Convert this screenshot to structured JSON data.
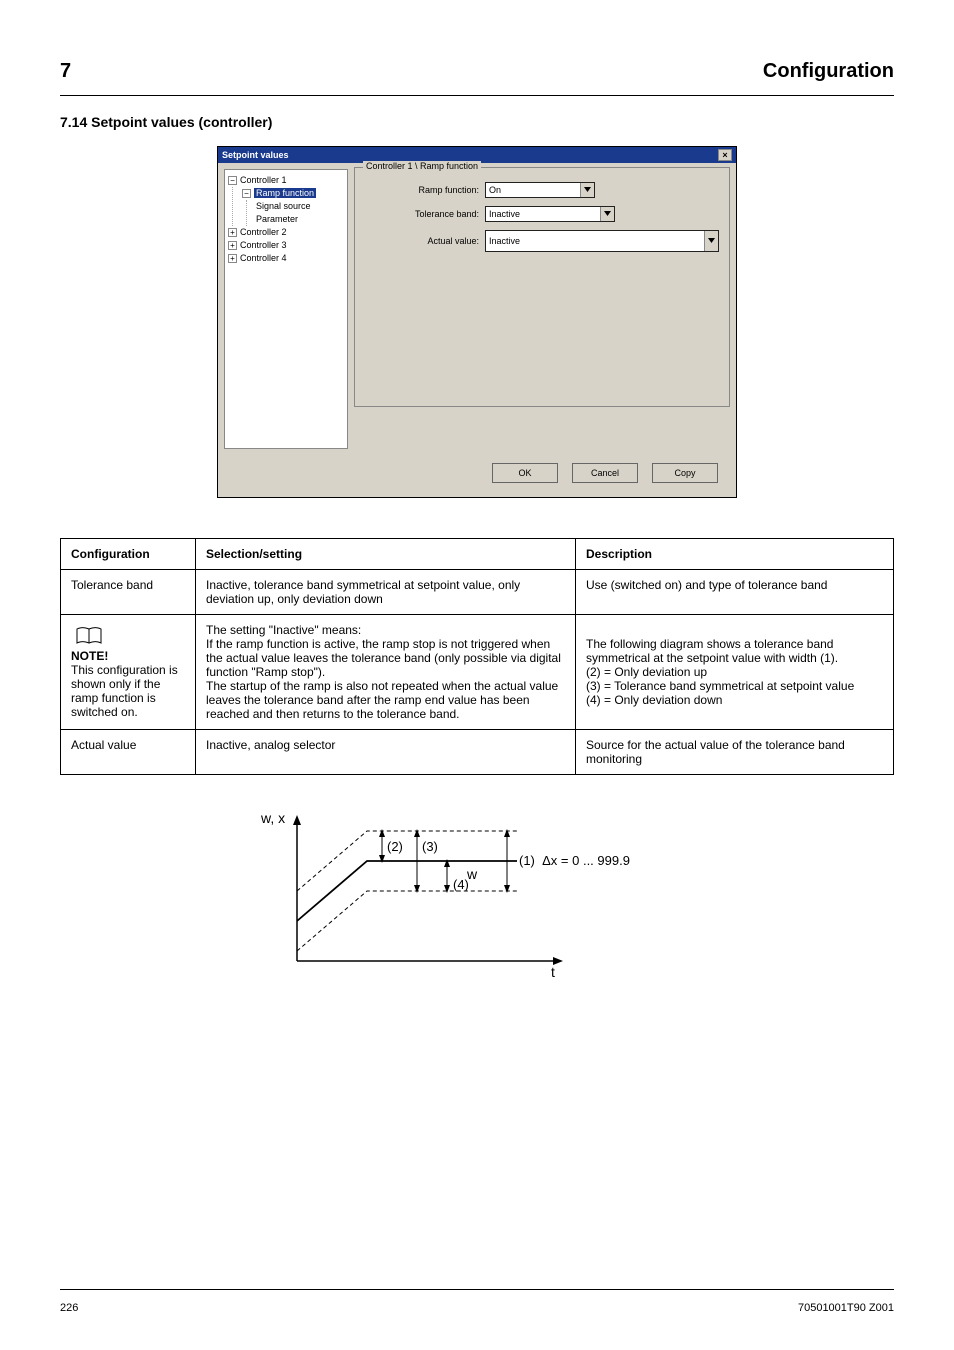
{
  "header": {
    "section_no": "7",
    "section_title": "Configuration",
    "page_title": "7.14 Setpoint values (controller)"
  },
  "dialog": {
    "title": "Setpoint values",
    "tree": {
      "c1": "Controller 1",
      "ramp": "Ramp function",
      "sig": "Signal source",
      "param": "Parameter",
      "c2": "Controller 2",
      "c3": "Controller 3",
      "c4": "Controller 4"
    },
    "group_title": "Controller 1 \\ Ramp function",
    "labels": {
      "rf": "Ramp function:",
      "tb": "Tolerance band:",
      "av": "Actual value:"
    },
    "values": {
      "rf": "On",
      "tb": "Inactive",
      "av": "Inactive"
    },
    "buttons": {
      "ok": "OK",
      "cancel": "Cancel",
      "copy": "Copy"
    }
  },
  "table": {
    "headers": {
      "c1": "Configuration",
      "c2": "Selection/setting",
      "c3": "Description"
    },
    "rows": [
      {
        "c1": "Tolerance band",
        "c2": "Inactive, tolerance band symmetrical at setpoint value, only deviation up, only deviation down",
        "c3": "Use (switched on) and type of tolerance band"
      }
    ],
    "note_row": {
      "c1_a": "NOTE!",
      "c1_b": "This configuration is shown only if the ramp function is switched on.",
      "c2_a": "The setting \"Inactive\" means:",
      "c2_b": "If the ramp function is active, the ramp stop is not triggered when the actual value leaves the tolerance band (only possible via digital function \"Ramp stop\").",
      "c2_c": "The startup of the ramp is also not repeated when the actual value leaves the tolerance band after the ramp end value has been reached and then returns to the tolerance band.",
      "c3_a": "The following diagram shows a tolerance band symmetrical at the setpoint value with width (1).",
      "c3_b": "(2) = Only deviation up",
      "c3_c": "(3) = Tolerance band symmetrical at setpoint value",
      "c3_d": "(4) = Only deviation down"
    },
    "actual_row": {
      "c1": "Actual value",
      "c2": "Inactive, analog selector",
      "c3": "Source for the actual value of the tolerance band monitoring"
    }
  },
  "chart_data": {
    "type": "line",
    "title": "",
    "xlabel": "t",
    "ylabel": "w, x",
    "annotations": [
      "(1)",
      "(2)",
      "(3)",
      "(4)",
      "w",
      "Δx = 0 ... 999.9"
    ]
  },
  "footer": {
    "left": "226",
    "right": "70501001T90  Z001"
  }
}
